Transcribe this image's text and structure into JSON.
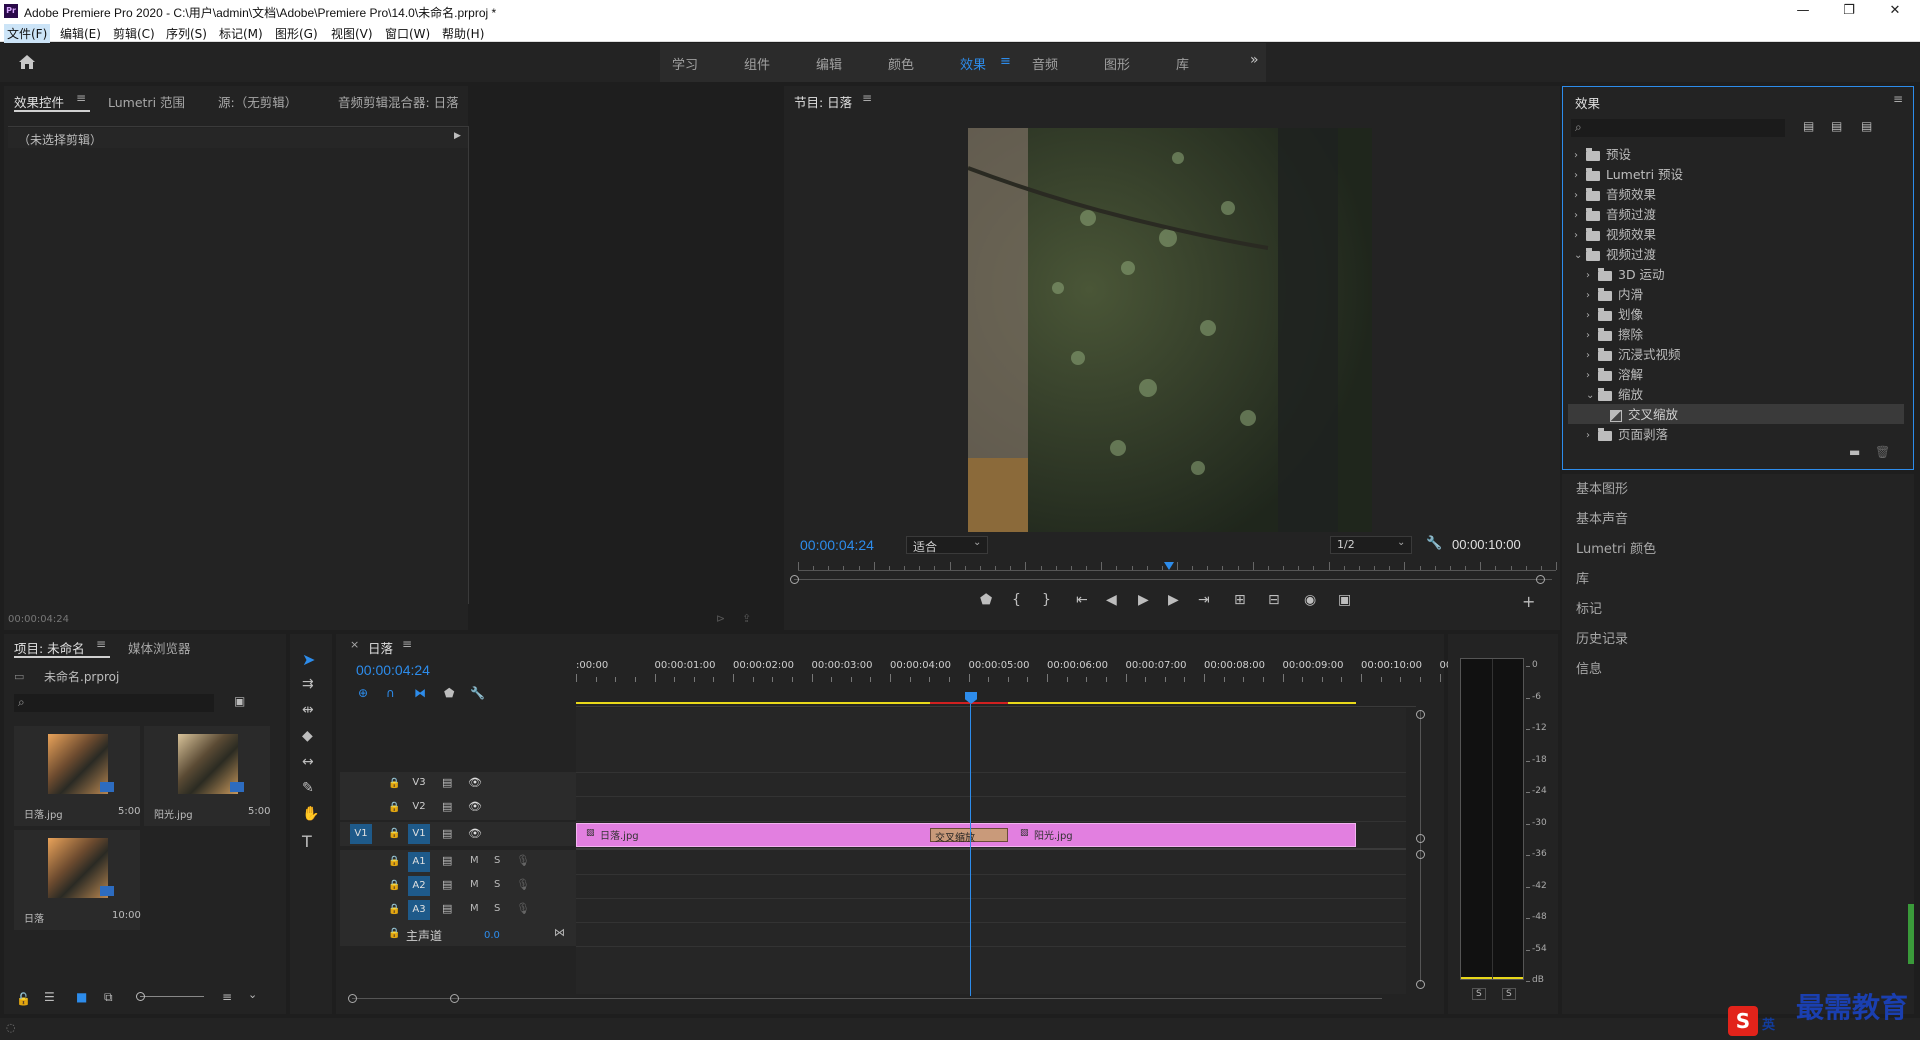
{
  "window": {
    "title": "Adobe Premiere Pro 2020 - C:\\用户\\admin\\文档\\Adobe\\Premiere Pro\\14.0\\未命名.prproj *",
    "app_icon": "Pr"
  },
  "menu": [
    "文件(F)",
    "编辑(E)",
    "剪辑(C)",
    "序列(S)",
    "标记(M)",
    "图形(G)",
    "视图(V)",
    "窗口(W)",
    "帮助(H)"
  ],
  "workspaces": [
    "学习",
    "组件",
    "编辑",
    "颜色",
    "效果",
    "音频",
    "图形",
    "库"
  ],
  "active_workspace": "效果",
  "left_panel": {
    "tabs": [
      "效果控件",
      "Lumetri 范围",
      "源:（无剪辑）",
      "音频剪辑混合器: 日落"
    ],
    "no_clip": "（未选择剪辑）",
    "timecode": "00:00:04:24"
  },
  "program": {
    "title": "节目: 日落",
    "timecode": "00:00:04:24",
    "fit": "适合",
    "quality": "1/2",
    "duration": "00:00:10:00",
    "playhead_fraction": 0.49
  },
  "effects": {
    "title": "效果",
    "items": [
      {
        "label": "预设",
        "indent": 0,
        "open": false,
        "icon": "preset-folder"
      },
      {
        "label": "Lumetri 预设",
        "indent": 0,
        "open": false,
        "icon": "preset-folder"
      },
      {
        "label": "音频效果",
        "indent": 0,
        "open": false,
        "icon": "folder"
      },
      {
        "label": "音频过渡",
        "indent": 0,
        "open": false,
        "icon": "folder"
      },
      {
        "label": "视频效果",
        "indent": 0,
        "open": false,
        "icon": "folder"
      },
      {
        "label": "视频过渡",
        "indent": 0,
        "open": true,
        "icon": "folder"
      },
      {
        "label": "3D 运动",
        "indent": 1,
        "open": false,
        "icon": "folder"
      },
      {
        "label": "内滑",
        "indent": 1,
        "open": false,
        "icon": "folder"
      },
      {
        "label": "划像",
        "indent": 1,
        "open": false,
        "icon": "folder"
      },
      {
        "label": "擦除",
        "indent": 1,
        "open": false,
        "icon": "folder"
      },
      {
        "label": "沉浸式视频",
        "indent": 1,
        "open": false,
        "icon": "folder"
      },
      {
        "label": "溶解",
        "indent": 1,
        "open": false,
        "icon": "folder"
      },
      {
        "label": "缩放",
        "indent": 1,
        "open": true,
        "icon": "folder"
      },
      {
        "label": "交叉缩放",
        "indent": 2,
        "open": false,
        "icon": "effect",
        "selected": true
      },
      {
        "label": "页面剥落",
        "indent": 1,
        "open": false,
        "icon": "folder"
      }
    ]
  },
  "side_panels": [
    "基本图形",
    "基本声音",
    "Lumetri 颜色",
    "库",
    "标记",
    "历史记录",
    "信息"
  ],
  "project": {
    "tabs": [
      "项目: 未命名",
      "媒体浏览器"
    ],
    "file": "未命名.prproj",
    "items": [
      {
        "name": "日落.jpg",
        "duration": "5:00"
      },
      {
        "name": "阳光.jpg",
        "duration": "5:00"
      },
      {
        "name": "日落",
        "duration": "10:00"
      }
    ]
  },
  "timeline": {
    "title": "日落",
    "timecode": "00:00:04:24",
    "ruler": [
      ":00:00",
      "00:00:01:00",
      "00:00:02:00",
      "00:00:03:00",
      "00:00:04:00",
      "00:00:05:00",
      "00:00:06:00",
      "00:00:07:00",
      "00:00:08:00",
      "00:00:09:00",
      "00:00:10:00",
      "00"
    ],
    "video_tracks": [
      "V3",
      "V2",
      "V1"
    ],
    "audio_tracks": [
      "A1",
      "A2",
      "A3"
    ],
    "source_patch": "V1",
    "master": "主声道",
    "master_value": "0.0",
    "clip_a": "日落.jpg",
    "clip_b": "阳光.jpg",
    "transition": "交叉缩放",
    "mute": "M",
    "solo": "S"
  },
  "meter": {
    "scale": [
      "0",
      "-6",
      "-12",
      "-18",
      "-24",
      "-30",
      "-36",
      "-42",
      "-48",
      "-54",
      "dB"
    ],
    "solo_left": "S",
    "solo_right": "S"
  },
  "watermark": {
    "text": "最需教育",
    "ime": "英"
  },
  "colors": {
    "accent": "#2d8ceb",
    "clip": "#e27fe0",
    "transition": "#c99a7a",
    "playhead": "#2d8ceb"
  }
}
